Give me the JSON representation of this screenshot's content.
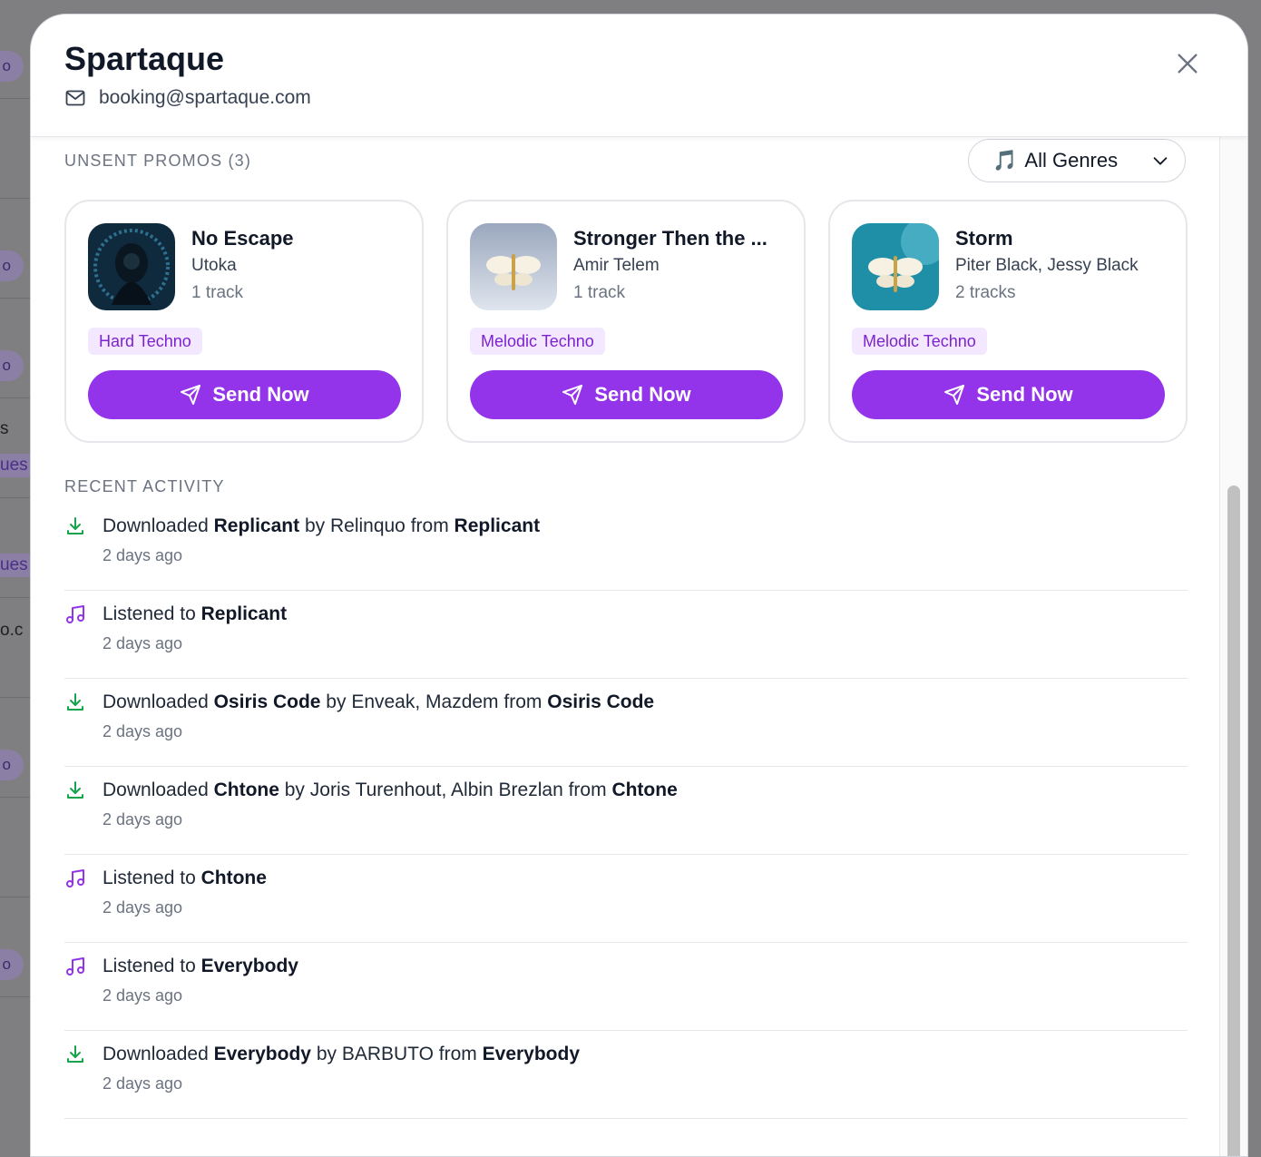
{
  "background": {
    "fragments": [
      "o",
      "o",
      "o",
      "s",
      "ues",
      "ues",
      "o.c",
      "o",
      "o"
    ]
  },
  "modal": {
    "title": "Spartaque",
    "email": "booking@spartaque.com",
    "close_icon": "close-icon"
  },
  "promos": {
    "section_label": "UNSENT PROMOS (3)",
    "genre_filter": {
      "note_icon": "🎵",
      "label": "All Genres"
    },
    "cards": [
      {
        "title": "No Escape",
        "artist": "Utoka",
        "tracks": "1 track",
        "genre": "Hard Techno",
        "button": "Send Now",
        "cover_color": "#0f2a3d"
      },
      {
        "title": "Stronger Then the ...",
        "artist": "Amir Telem",
        "tracks": "1 track",
        "genre": "Melodic Techno",
        "button": "Send Now",
        "cover_color": "#b8c4d6"
      },
      {
        "title": "Storm",
        "artist": "Piter Black, Jessy Black",
        "tracks": "2 tracks",
        "genre": "Melodic Techno",
        "button": "Send Now",
        "cover_color": "#1f8fa8"
      }
    ]
  },
  "activity": {
    "section_label": "RECENT ACTIVITY",
    "items": [
      {
        "type": "download",
        "verb": "Downloaded ",
        "track": "Replicant",
        "by": " by Relinquo from ",
        "release": "Replicant",
        "time": "2 days ago"
      },
      {
        "type": "listen",
        "verb": "Listened to ",
        "track": "Replicant",
        "by": "",
        "release": "",
        "time": "2 days ago"
      },
      {
        "type": "download",
        "verb": "Downloaded ",
        "track": "Osiris Code",
        "by": " by Enveak, Mazdem from ",
        "release": "Osiris Code",
        "time": "2 days ago"
      },
      {
        "type": "download",
        "verb": "Downloaded ",
        "track": "Chtone",
        "by": " by Joris Turenhout, Albin Brezlan from ",
        "release": "Chtone",
        "time": "2 days ago"
      },
      {
        "type": "listen",
        "verb": "Listened to ",
        "track": "Chtone",
        "by": "",
        "release": "",
        "time": "2 days ago"
      },
      {
        "type": "listen",
        "verb": "Listened to ",
        "track": "Everybody",
        "by": "",
        "release": "",
        "time": "2 days ago"
      },
      {
        "type": "download",
        "verb": "Downloaded ",
        "track": "Everybody",
        "by": " by BARBUTO from ",
        "release": "Everybody",
        "time": "2 days ago"
      }
    ]
  },
  "colors": {
    "accent": "#9333ea",
    "tag_bg": "#f3e8ff",
    "tag_text": "#7e22ce",
    "download_icon": "#16a34a",
    "listen_icon": "#9333ea"
  }
}
